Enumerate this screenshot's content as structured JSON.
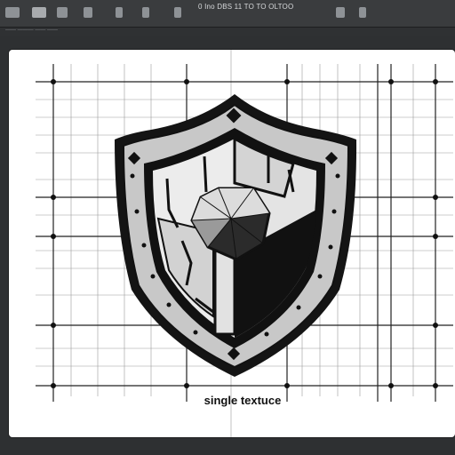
{
  "app": {
    "menubar_text": "0 Ino DBS 11 TO TO OLTOO",
    "options_text": "—— ——— —— ——"
  },
  "canvas": {
    "caption": "single textuce"
  },
  "colors": {
    "workspace": "#2e3032",
    "toolbar": "#3a3c3e",
    "shield_dark": "#111111",
    "shield_metal": "#c9c9c9",
    "grid": "#888888"
  }
}
